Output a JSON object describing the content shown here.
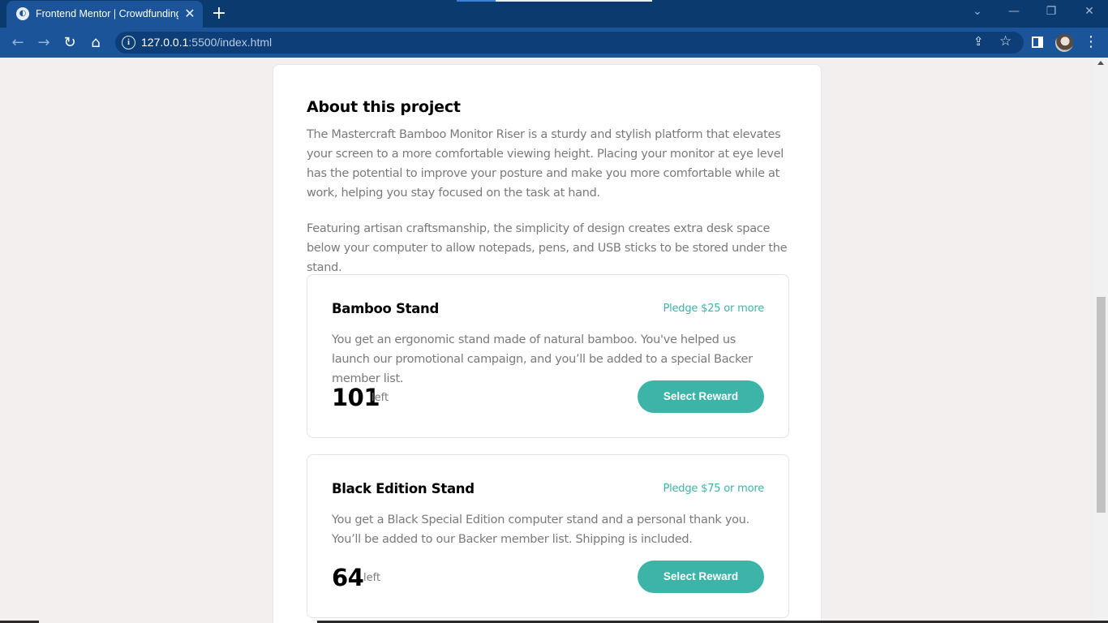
{
  "browser": {
    "tab_title": "Frontend Mentor | Crowdfunding",
    "tab_favicon": "frontend-mentor-icon",
    "tab_close": "✕",
    "new_tab": "+",
    "url_host": "127.0.0.1",
    "url_rest": ":5500/index.html",
    "info": "i"
  },
  "about": {
    "title": "About this project",
    "paragraph1": "The Mastercraft Bamboo Monitor Riser is a sturdy and stylish platform that elevates your screen to a more comfortable viewing height. Placing your monitor at eye level has the potential to improve your posture and make you more comfortable while at work, helping you stay focused on the task at hand.",
    "paragraph2": "Featuring artisan craftsmanship, the simplicity of design creates extra desk space below your computer to allow notepads, pens, and USB sticks to be stored under the stand."
  },
  "rewards": [
    {
      "name": "Bamboo Stand",
      "pledge": "Pledge $25 or more",
      "description": "You get an ergonomic stand made of natural bamboo. You've helped us launch our promotional campaign, and you’ll be added to a special Backer member list.",
      "count": "101",
      "left_label": "left",
      "button": "Select Reward"
    },
    {
      "name": "Black Edition Stand",
      "pledge": "Pledge $75 or more",
      "description": "You get a Black Special Edition computer stand and a personal thank you. You’ll be added to our Backer member list. Shipping is included.",
      "count": "64",
      "left_label": "left",
      "button": "Select Reward"
    }
  ],
  "colors": {
    "accent": "#3cb4a8",
    "page_bg": "#f4efef",
    "chrome": "#1b5499"
  }
}
